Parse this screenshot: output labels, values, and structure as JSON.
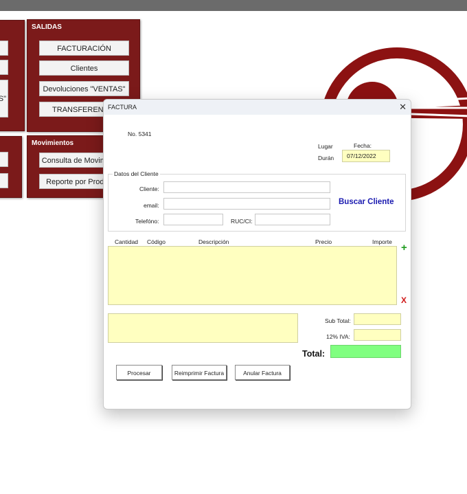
{
  "background": {
    "salidas": {
      "title": "SALIDAS",
      "buttons": [
        "FACTURACIÓN",
        "Clientes",
        "Devoluciones \"VENTAS\"",
        "TRANSFERENCIA"
      ]
    },
    "movimientos": {
      "title": "Movimientos",
      "buttons": [
        "Consulta de Movimientos",
        "Reporte por Productos"
      ]
    },
    "left_fragment": "S\""
  },
  "dialog": {
    "title": "FACTURA",
    "close_glyph": "✕",
    "number": "No. 5341",
    "lugar_label": "Lugar",
    "lugar_value": "Durán",
    "fecha_label": "Fecha:",
    "fecha_value": "07/12/2022",
    "cliente_section": {
      "legend": "Datos del Cliente",
      "cliente_label": "Cliente:",
      "email_label": "email:",
      "telefono_label": "Telefóno:",
      "ruc_label": "RUC/CI:",
      "buscar_label": "Buscar Cliente"
    },
    "table_headers": [
      "Cantidad",
      "Código",
      "Descripción",
      "Precio",
      "Importe"
    ],
    "add_glyph": "+",
    "remove_glyph": "X",
    "subtotal_label": "Sub Total:",
    "iva_label": "12% IVA:",
    "total_label": "Total:",
    "buttons": {
      "procesar": "Procesar",
      "reimprimir": "Reimprimir Factura",
      "anular": "Anular Factura"
    }
  },
  "colors": {
    "panel": "#7b1a1a",
    "input_yellow": "#ffffc0",
    "total_green": "#80ff80",
    "link_blue": "#1a1ab0"
  }
}
